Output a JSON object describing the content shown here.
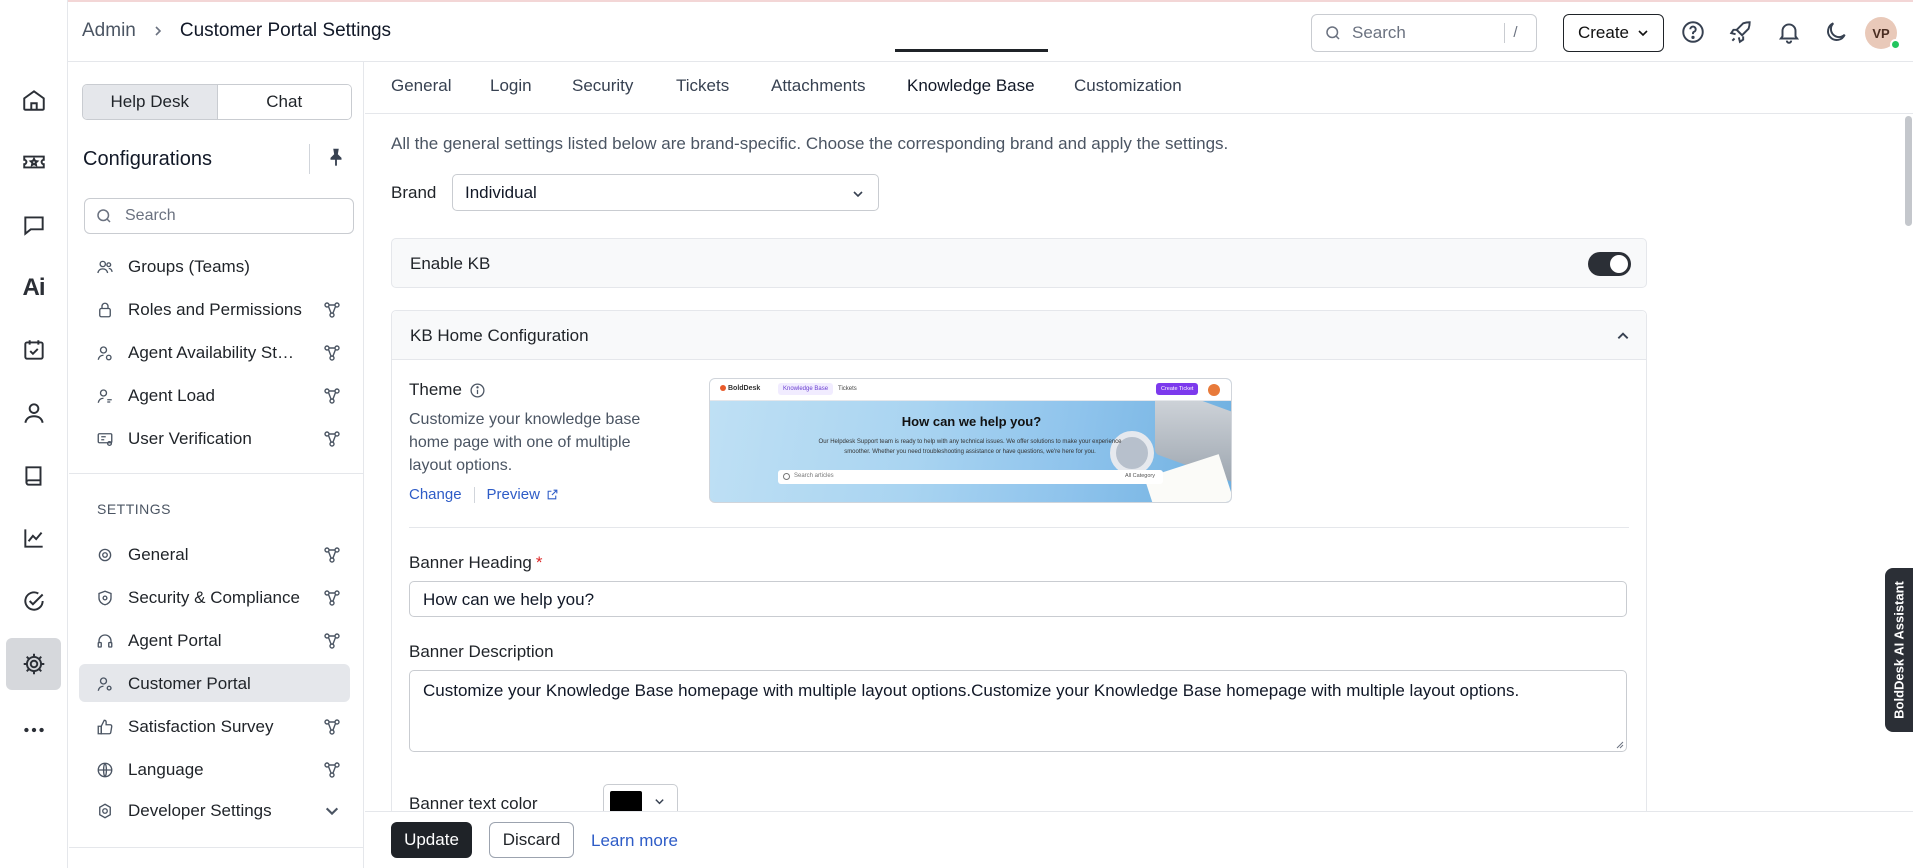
{
  "header": {
    "breadcrumb_root": "Admin",
    "page_title": "Customer Portal Settings",
    "search_placeholder": "Search",
    "search_shortcut": "/",
    "create_label": "Create",
    "avatar_initials": "VP"
  },
  "sidebar": {
    "segments": [
      "Help Desk",
      "Chat"
    ],
    "title": "Configurations",
    "search_placeholder": "Search",
    "config_items": [
      {
        "label": "Groups (Teams)",
        "icon": "users-icon"
      },
      {
        "label": "Roles and Permissions",
        "icon": "lock-icon"
      },
      {
        "label": "Agent Availability Statuses",
        "icon": "user-status-icon"
      },
      {
        "label": "Agent Load",
        "icon": "user-load-icon"
      },
      {
        "label": "User Verification",
        "icon": "id-card-icon"
      }
    ],
    "settings_heading": "SETTINGS",
    "settings_items": [
      {
        "label": "General",
        "icon": "gear-icon"
      },
      {
        "label": "Security & Compliance",
        "icon": "shield-icon"
      },
      {
        "label": "Agent Portal",
        "icon": "headset-icon"
      },
      {
        "label": "Customer Portal",
        "icon": "user-gear-icon"
      },
      {
        "label": "Satisfaction Survey",
        "icon": "thumbs-up-icon"
      },
      {
        "label": "Language",
        "icon": "globe-icon"
      },
      {
        "label": "Developer Settings",
        "icon": "code-gear-icon"
      }
    ]
  },
  "tabs": [
    "General",
    "Login",
    "Security",
    "Tickets",
    "Attachments",
    "Knowledge Base",
    "Customization"
  ],
  "active_tab": "Knowledge Base",
  "main": {
    "intro": "All the general settings listed below are brand-specific. Choose the corresponding brand and apply the settings.",
    "brand_label": "Brand",
    "brand_value": "Individual",
    "enable_kb_label": "Enable KB",
    "enable_kb_on": true,
    "kb_home_title": "KB Home Configuration",
    "theme_label": "Theme",
    "theme_desc": "Customize your knowledge base home page with one of multiple layout options.",
    "change_link": "Change",
    "preview_link": "Preview",
    "preview_thumb": {
      "logo": "BoldDesk",
      "tab_kb": "Knowledge Base",
      "tab_tickets": "Tickets",
      "cta": "Create Ticket",
      "heading": "How can we help you?",
      "para": "Our Helpdesk Support team is ready to help with any technical issues. We offer solutions to make your experience smoother. Whether you need troubleshooting assistance or have questions, we're here for you.",
      "search": "Search articles",
      "category": "All Category"
    },
    "banner_heading_label": "Banner Heading",
    "banner_heading_value": "How can we help you?",
    "banner_desc_label": "Banner Description",
    "banner_desc_value": "Customize your Knowledge Base homepage with multiple layout options.Customize your Knowledge Base homepage with multiple layout options.",
    "banner_text_color_label": "Banner text color",
    "banner_text_color": "#000000"
  },
  "footer": {
    "update_label": "Update",
    "discard_label": "Discard",
    "learn_more": "Learn more"
  },
  "ai_assistant_label": "BoldDesk AI Assistant",
  "colors": {
    "accent": "#1f2328",
    "link": "#2e5cc7",
    "required": "#dc2626"
  }
}
